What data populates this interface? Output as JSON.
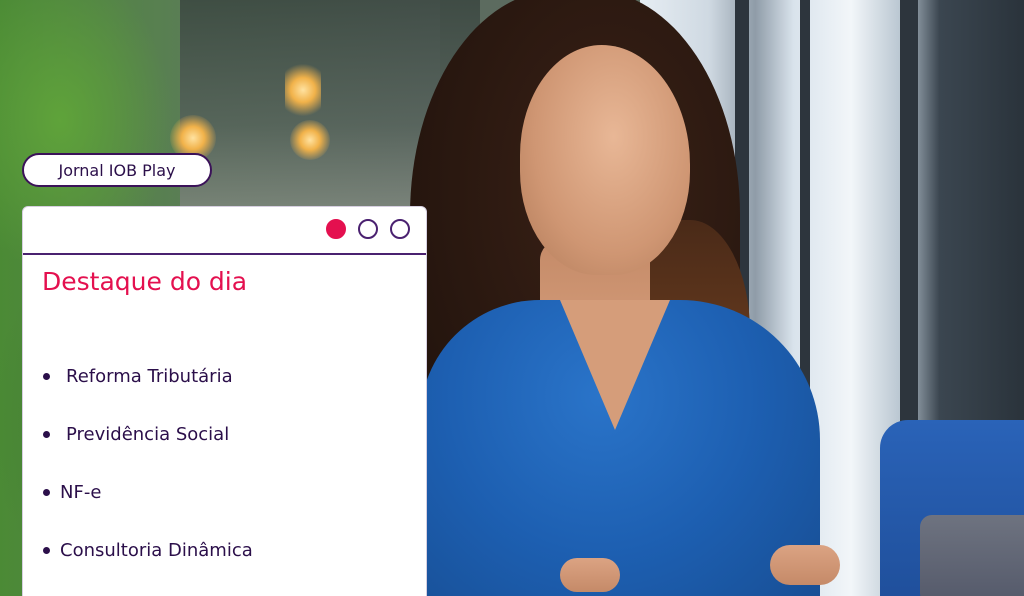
{
  "tag": {
    "label": "Jornal IOB Play"
  },
  "card": {
    "title": "Destaque do dia",
    "carousel": {
      "total": 3,
      "active_index": 0
    },
    "topics": [
      {
        "label": "Reforma Tributária"
      },
      {
        "label": "Previdência Social"
      },
      {
        "label": "NF-e"
      },
      {
        "label": "Consultoria Dinâmica"
      }
    ]
  },
  "colors": {
    "accent": "#e4104f",
    "brand_purple": "#4a2170",
    "text": "#2b0f4a"
  }
}
